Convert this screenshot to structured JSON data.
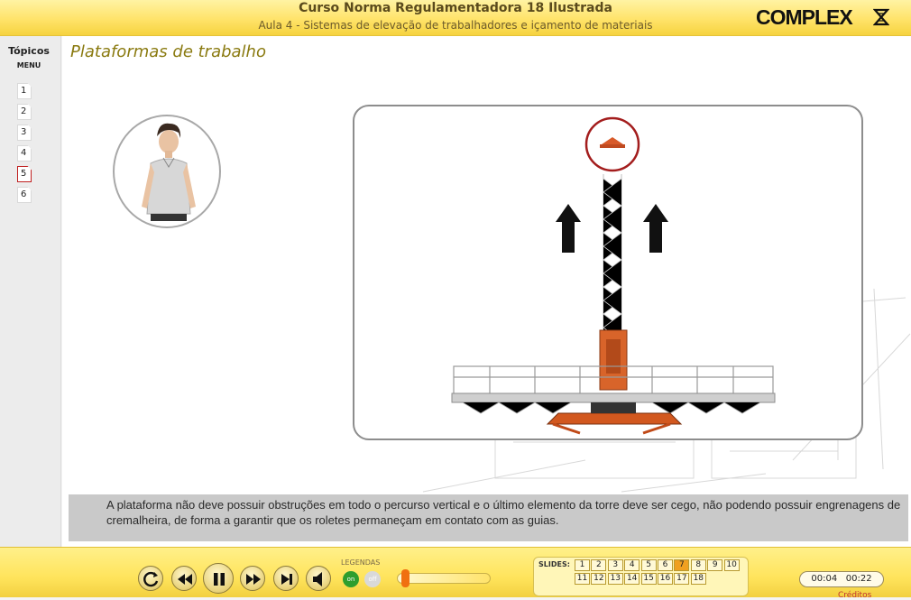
{
  "header": {
    "course_title": "Curso Norma Regulamentadora 18 Ilustrada",
    "lesson_title": "Aula 4 - Sistemas de elevação de trabalhadores e içamento de materiais",
    "logo": "COMPLEX"
  },
  "sidebar": {
    "title": "Tópicos",
    "menu_label": "MENU",
    "items": [
      {
        "label": "1"
      },
      {
        "label": "2"
      },
      {
        "label": "3"
      },
      {
        "label": "4"
      },
      {
        "label": "5",
        "active": true
      },
      {
        "label": "6"
      }
    ]
  },
  "main": {
    "page_title": "Plataformas de trabalho",
    "caption": "A plataforma não deve possuir obstruções em todo o percurso vertical e o último elemento da torre deve ser cego, não podendo possuir engrenagens de cremalheira, de forma a garantir que os roletes permaneçam em contato com as guias."
  },
  "footer": {
    "legend_label": "LEGENDAS",
    "legend_on": "on",
    "legend_off": "off",
    "volume_level": 0.05,
    "slides_label": "SLIDES:",
    "slides_row1": [
      "1",
      "2",
      "3",
      "4",
      "5",
      "6",
      "7",
      "8",
      "9",
      "10"
    ],
    "slides_row2": [
      "11",
      "12",
      "13",
      "14",
      "15",
      "16",
      "17",
      "18"
    ],
    "current_slide": "7",
    "elapsed": "00:04",
    "total": "00:22",
    "credits": "Créditos"
  },
  "colors": {
    "accent_yellow": "#ffe36a",
    "title_olive": "#8a7a10",
    "highlight_red": "#a31d1d",
    "active_slide": "#f0a020"
  },
  "icons": [
    "replay-icon",
    "rewind-icon",
    "pause-icon",
    "fast-forward-icon",
    "skip-end-icon",
    "volume-icon"
  ]
}
